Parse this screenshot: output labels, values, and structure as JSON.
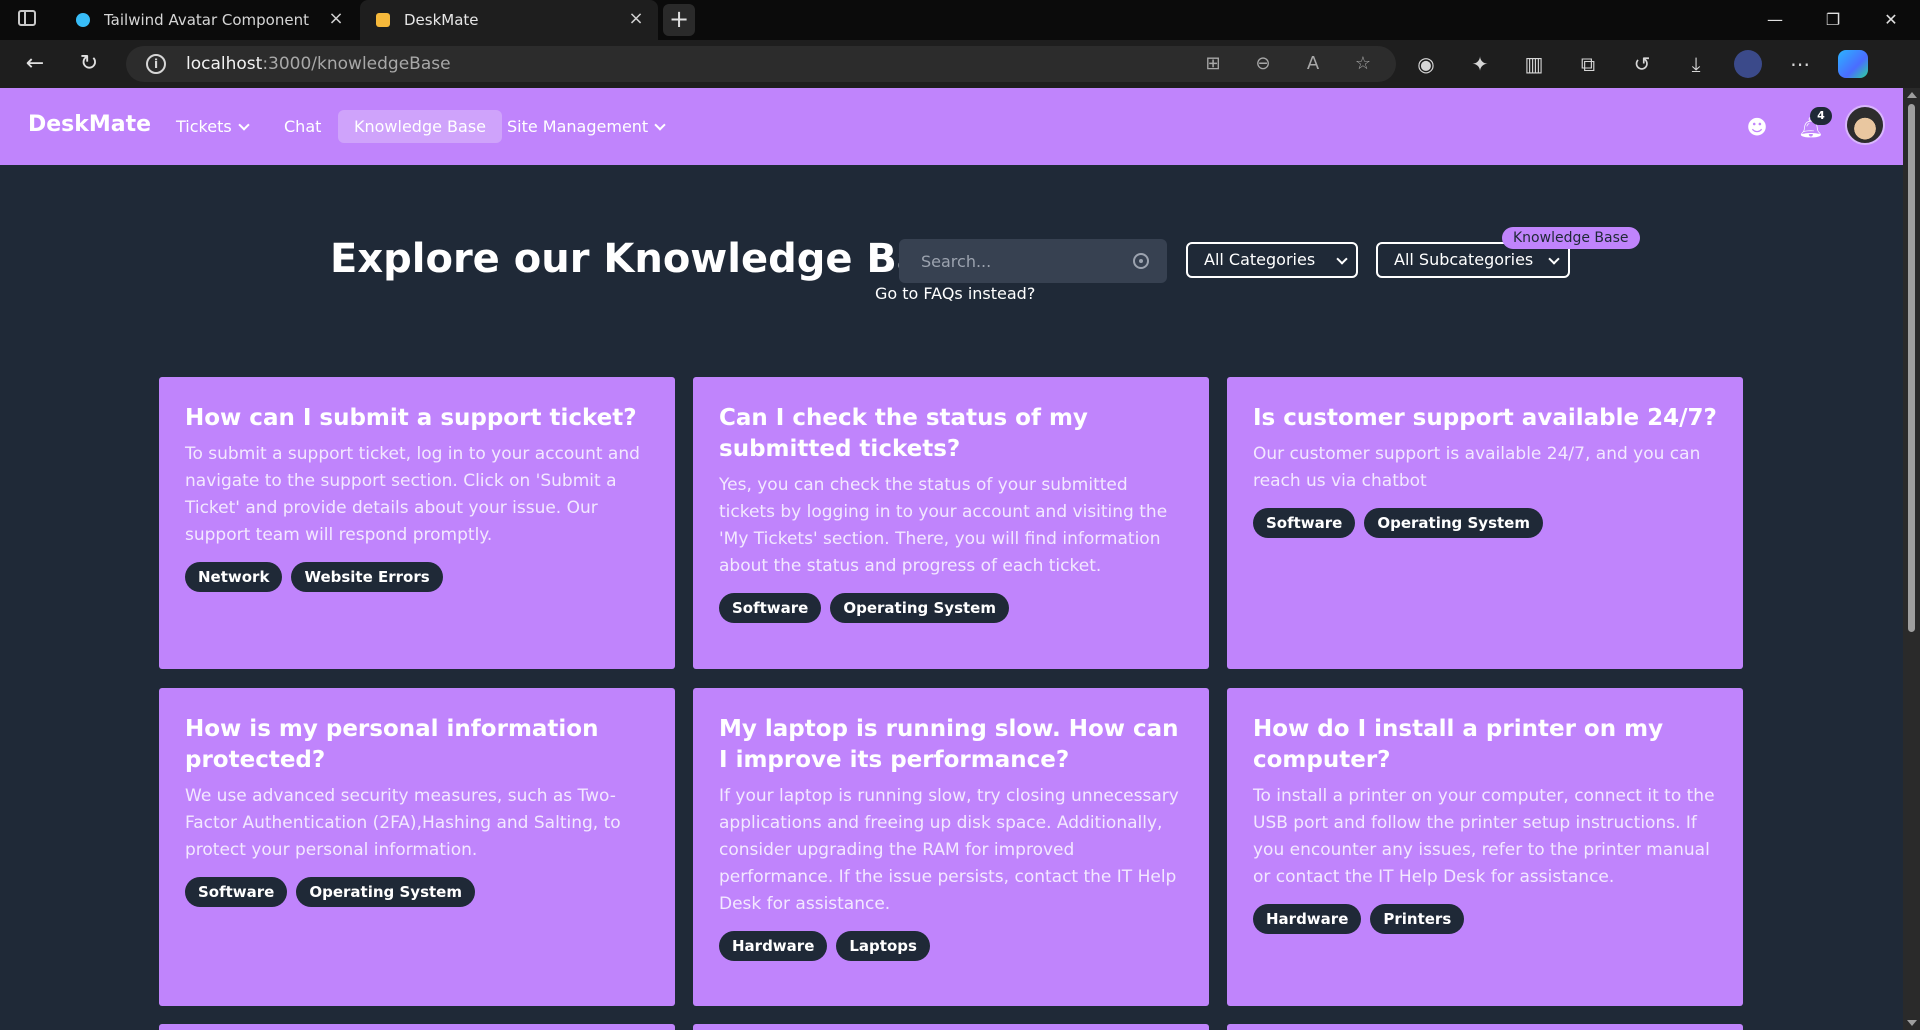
{
  "browser": {
    "tabs": [
      {
        "title": "Tailwind Avatar Component — Ta",
        "favicon_color": "#38bdf8"
      },
      {
        "title": "DeskMate",
        "favicon_color": "#f6b93b"
      }
    ],
    "tab_close_icon": "×",
    "new_tab_icon": "+",
    "url_host": "localhost",
    "url_path": ":3000/knowledgeBase",
    "window_controls": {
      "minimize": "—",
      "maximize": "❐",
      "close": "✕"
    }
  },
  "app": {
    "brand": "DeskMate",
    "nav": [
      {
        "label": "Tickets",
        "has_caret": true
      },
      {
        "label": "Chat",
        "has_caret": false
      },
      {
        "label": "Knowledge Base",
        "active": true
      },
      {
        "label": "Site Management",
        "has_caret": true
      }
    ],
    "notifications_count": "4",
    "accent_color": "#c084fc",
    "background_color": "#1f2937"
  },
  "hero": {
    "title": "Explore our Knowledge Base",
    "search_placeholder": "Search...",
    "category_select": "All Categories",
    "subcategory_select": "All Subcategories",
    "tooltip_pill": "Knowledge Base",
    "faq_link": "Go to FAQs instead?"
  },
  "articles": [
    {
      "title": "How can I submit a support ticket?",
      "body": "To submit a support ticket, log in to your account and navigate to the support section. Click on 'Submit a Ticket' and provide details about your issue. Our support team will respond promptly.",
      "tags": [
        "Network",
        "Website Errors"
      ]
    },
    {
      "title": "Can I check the status of my submitted tickets?",
      "body": "Yes, you can check the status of your submitted tickets by logging in to your account and visiting the 'My Tickets' section. There, you will find information about the status and progress of each ticket.",
      "tags": [
        "Software",
        "Operating System"
      ]
    },
    {
      "title": "Is customer support available 24/7?",
      "body": "Our customer support is available 24/7, and you can reach us via chatbot",
      "tags": [
        "Software",
        "Operating System"
      ]
    },
    {
      "title": "How is my personal information protected?",
      "body": "We use advanced security measures, such as Two-Factor Authentication (2FA),Hashing and Salting, to protect your personal information.",
      "tags": [
        "Software",
        "Operating System"
      ]
    },
    {
      "title": "My laptop is running slow. How can I improve its performance?",
      "body": "If your laptop is running slow, try closing unnecessary applications and freeing up disk space. Additionally, consider upgrading the RAM for improved performance. If the issue persists, contact the IT Help Desk for assistance.",
      "tags": [
        "Hardware",
        "Laptops"
      ]
    },
    {
      "title": "How do I install a printer on my computer?",
      "body": "To install a printer on your computer, connect it to the USB port and follow the printer setup instructions. If you encounter any issues, refer to the printer manual or contact the IT Help Desk for assistance.",
      "tags": [
        "Hardware",
        "Printers"
      ]
    }
  ]
}
